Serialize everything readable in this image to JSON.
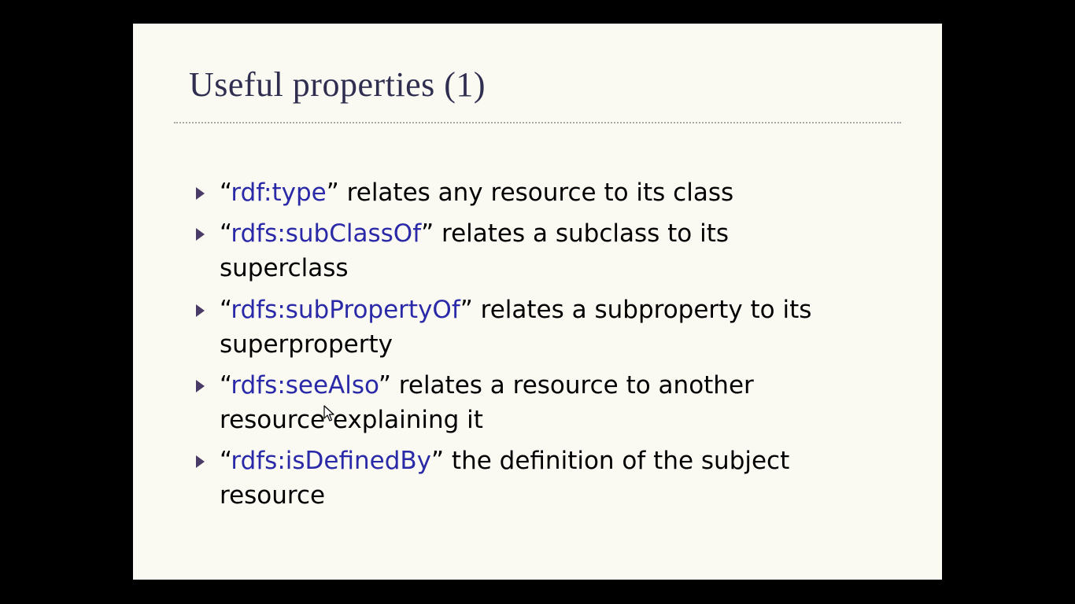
{
  "slide": {
    "title": "Useful properties (1)",
    "bullets": [
      {
        "open": "“",
        "term": "rdf:type",
        "close": "”",
        "rest": " relates any resource to its class"
      },
      {
        "open": "“",
        "term": "rdfs:subClassOf",
        "close": "”",
        "rest": " relates a subclass to its superclass"
      },
      {
        "open": "“",
        "term": "rdfs:subPropertyOf",
        "close": "”",
        "rest": " relates a subproperty to its superproperty"
      },
      {
        "open": "“",
        "term": "rdfs:seeAlso",
        "close": "”",
        "rest": " relates a resource to another resource explaining it"
      },
      {
        "open": "“",
        "term": "rdfs:isDefinedBy",
        "close": "”",
        "rest": " the definition of the subject resource"
      }
    ]
  },
  "colors": {
    "title": "#2f2e50",
    "term": "#2a2aa8",
    "bullet_marker": "#4a3a68",
    "slide_background": "#fbfaf2",
    "screen_background": "#000000"
  },
  "icons": {
    "bullet_marker": "triangle-right-icon",
    "cursor": "mouse-pointer-icon"
  }
}
